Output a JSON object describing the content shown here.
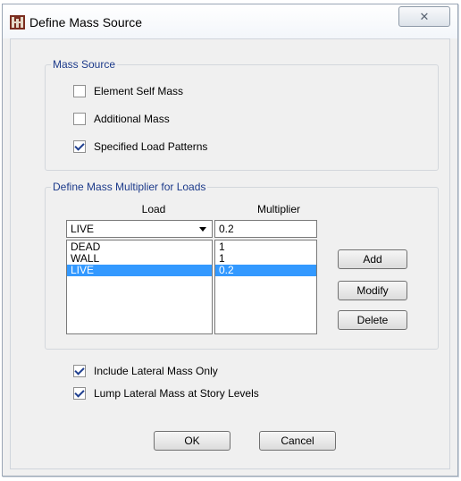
{
  "window": {
    "title": "Define Mass Source",
    "close_glyph": "✕"
  },
  "mass_source": {
    "legend": "Mass Source",
    "options": [
      {
        "label": "Element Self Mass",
        "checked": false
      },
      {
        "label": "Additional Mass",
        "checked": false
      },
      {
        "label": "Specified Load Patterns",
        "checked": true
      }
    ]
  },
  "multiplier_group": {
    "legend": "Define Mass Multiplier for Loads",
    "load_header": "Load",
    "multiplier_header": "Multiplier",
    "load_combo_value": "LIVE",
    "multiplier_input_value": "0.2",
    "rows": [
      {
        "load": "DEAD",
        "multiplier": "1",
        "selected": false
      },
      {
        "load": "WALL",
        "multiplier": "1",
        "selected": false
      },
      {
        "load": "LIVE",
        "multiplier": "0.2",
        "selected": true
      }
    ],
    "add_label": "Add",
    "modify_label": "Modify",
    "delete_label": "Delete"
  },
  "options": {
    "include_lateral": {
      "label": "Include Lateral Mass Only",
      "checked": true
    },
    "lump_lateral": {
      "label": "Lump Lateral Mass at Story Levels",
      "checked": true
    }
  },
  "buttons": {
    "ok": "OK",
    "cancel": "Cancel"
  },
  "icons": {
    "app": "etabs-app-icon",
    "close": "close-icon",
    "dropdown": "chevron-down-icon"
  }
}
